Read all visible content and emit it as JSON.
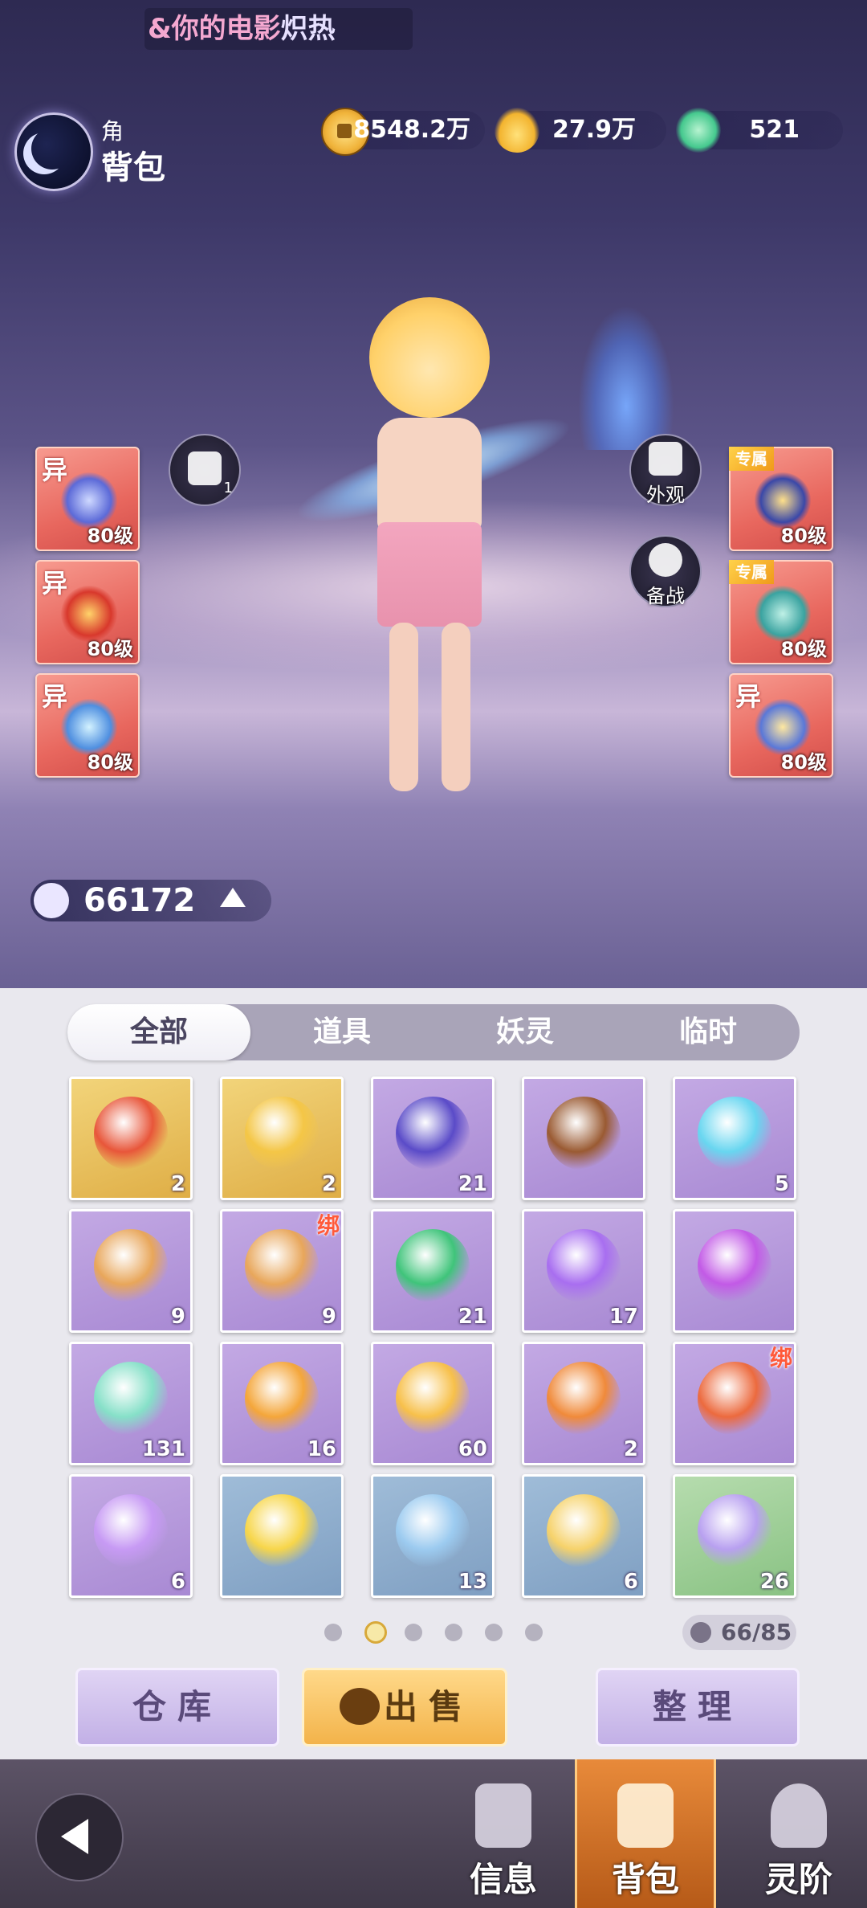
{
  "ticker": {
    "text_a": "&你的电影",
    "text_b": "炽热"
  },
  "header": {
    "subtitle": "角色",
    "title": "背包"
  },
  "currencies": [
    {
      "icon": "copper-coin-icon",
      "value": "8548.2万"
    },
    {
      "icon": "gold-ingot-icon",
      "value": "27.9万"
    },
    {
      "icon": "jade-token-icon",
      "value": "521"
    }
  ],
  "left_equipment": [
    {
      "tag": "异",
      "level": "80级",
      "icon": "flute-icon"
    },
    {
      "tag": "异",
      "level": "80级",
      "icon": "red-ornament-icon"
    },
    {
      "tag": "异",
      "level": "80级",
      "icon": "blue-bird-icon"
    }
  ],
  "right_equipment": [
    {
      "tag": "专属",
      "level": "80级",
      "icon": "helmet-icon"
    },
    {
      "tag": "专属",
      "level": "80级",
      "icon": "belt-icon"
    },
    {
      "tag": "异",
      "level": "80级",
      "icon": "boots-icon"
    }
  ],
  "armor_button": {
    "icon": "armor-icon",
    "count": "1"
  },
  "appearance_button": {
    "icon": "hanger-icon",
    "label": "外观"
  },
  "standby_button": {
    "icon": "spirit-icon",
    "label": "备战"
  },
  "power": {
    "icon": "power-icon",
    "value": "66172"
  },
  "tabs": [
    {
      "label": "全部",
      "active": true
    },
    {
      "label": "道具",
      "active": false
    },
    {
      "label": "妖灵",
      "active": false
    },
    {
      "label": "临时",
      "active": false
    }
  ],
  "items": [
    {
      "rarity": "gold",
      "icon": "feather-icon",
      "count": "2",
      "bound": ""
    },
    {
      "rarity": "gold",
      "icon": "gold-scales-icon",
      "count": "2",
      "bound": ""
    },
    {
      "rarity": "purple",
      "icon": "purple-orb-icon",
      "count": "21",
      "bound": ""
    },
    {
      "rarity": "purple",
      "icon": "wine-jar-icon",
      "count": "",
      "bound": ""
    },
    {
      "rarity": "purple",
      "icon": "blue-gem-icon",
      "count": "5",
      "bound": ""
    },
    {
      "rarity": "purple",
      "icon": "rope-icon",
      "count": "9",
      "bound": ""
    },
    {
      "rarity": "purple",
      "icon": "rope-icon",
      "count": "9",
      "bound": "绑"
    },
    {
      "rarity": "purple",
      "icon": "green-orb-icon",
      "count": "21",
      "bound": ""
    },
    {
      "rarity": "purple",
      "icon": "rainbow-gem-icon",
      "count": "17",
      "bound": ""
    },
    {
      "rarity": "purple",
      "icon": "crystal-ball-icon",
      "count": "",
      "bound": ""
    },
    {
      "rarity": "purple",
      "icon": "potion-bottle-icon",
      "count": "131",
      "bound": ""
    },
    {
      "rarity": "purple",
      "icon": "amber-stone-icon",
      "count": "16",
      "bound": ""
    },
    {
      "rarity": "purple",
      "icon": "amber-crystal-icon",
      "count": "60",
      "bound": ""
    },
    {
      "rarity": "purple",
      "icon": "swirl-stone-icon",
      "count": "2",
      "bound": ""
    },
    {
      "rarity": "purple",
      "icon": "orange-pouch-icon",
      "count": "",
      "bound": "绑"
    },
    {
      "rarity": "purple",
      "icon": "violet-crystal-icon",
      "count": "6",
      "bound": ""
    },
    {
      "rarity": "blue",
      "icon": "yellow-flower-icon",
      "count": "",
      "bound": ""
    },
    {
      "rarity": "blue",
      "icon": "scroll-icon",
      "count": "13",
      "bound": ""
    },
    {
      "rarity": "blue",
      "icon": "gold-ingot-item-icon",
      "count": "6",
      "bound": ""
    },
    {
      "rarity": "green",
      "icon": "lotus-icon",
      "count": "26",
      "bound": ""
    }
  ],
  "pagination": {
    "pages": 6,
    "current": 2
  },
  "capacity": {
    "icon": "bag-icon",
    "text": "66/85"
  },
  "actions": {
    "warehouse": "仓库",
    "sell": "出售",
    "sort": "整理"
  },
  "nav": [
    {
      "label": "信息",
      "icon": "fist-icon",
      "active": false
    },
    {
      "label": "背包",
      "icon": "bag-icon",
      "active": true
    },
    {
      "label": "灵阶",
      "icon": "flame-icon",
      "active": false
    }
  ],
  "colors": {
    "tab_bg": "#a9a4b8",
    "panel_bg": "#e9e8ee",
    "equip_red": "#e8675e",
    "nav_active": "#e88a3a"
  }
}
